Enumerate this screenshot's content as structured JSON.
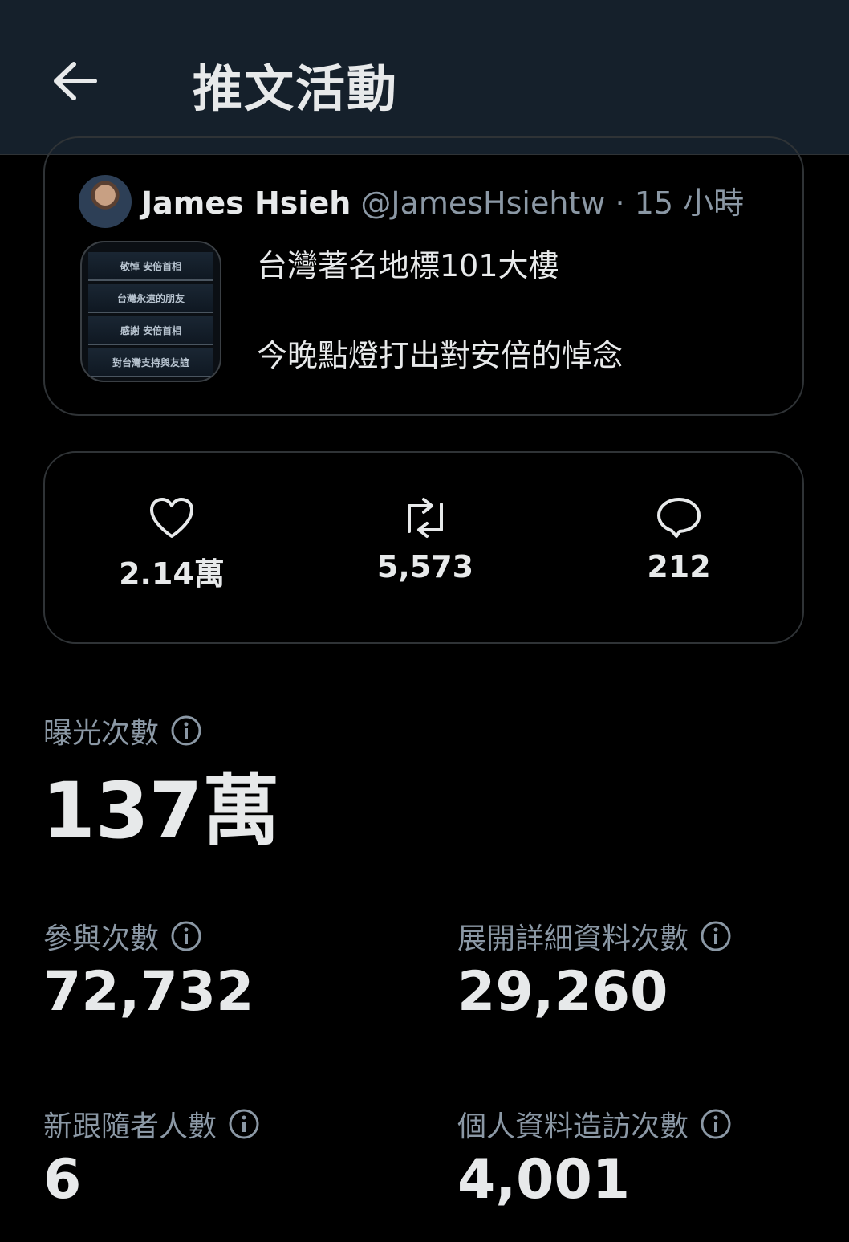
{
  "header": {
    "title": "推文活動"
  },
  "tweet": {
    "author_name": "James Hsieh",
    "author_handle": "@JamesHsiehtw",
    "separator": " · ",
    "time": "15 小時",
    "lines": [
      "台灣著名地標101大樓",
      "今晚點燈打出對安倍的悼念"
    ],
    "image_bands": [
      "敬悼 安倍首相",
      "台灣永遠的朋友",
      "感謝 安倍首相",
      "對台灣支持與友誼"
    ]
  },
  "engagement": {
    "likes": "2.14萬",
    "retweets": "5,573",
    "replies": "212"
  },
  "metrics": {
    "impressions": {
      "label": "曝光次數",
      "value": "137萬"
    },
    "engagements": {
      "label": "參與次數",
      "value": "72,732"
    },
    "detail_expands": {
      "label": "展開詳細資料次數",
      "value": "29,260"
    },
    "new_followers": {
      "label": "新跟隨者人數",
      "value": "6"
    },
    "profile_visits": {
      "label": "個人資料造訪次數",
      "value": "4,001"
    }
  },
  "colors": {
    "header_bg": "#15202b",
    "text": "#e7e9ea",
    "secondary": "#8b98a5",
    "border": "#2f3336"
  }
}
